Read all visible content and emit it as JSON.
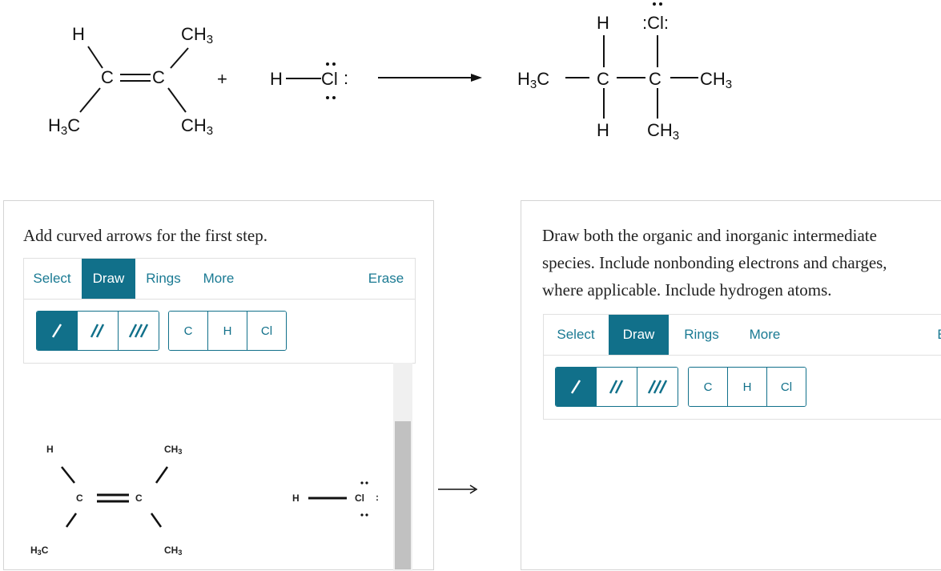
{
  "reaction": {
    "reactant1": {
      "h": "H",
      "ch3_top": "CH",
      "ch3_top_sub": "3",
      "c1": "C",
      "c2": "C",
      "h3c": "H",
      "h3c_sub": "3",
      "h3c_c": "C",
      "ch3_bot": "CH",
      "ch3_bot_sub": "3"
    },
    "plus": "+",
    "reactant2": {
      "h": "H",
      "cl": "Cl",
      "lone_pair": ":"
    },
    "product": {
      "h_top": "H",
      "cl": ":Cl:",
      "h3c": "H",
      "h3c_sub": "3",
      "h3c_c": "C",
      "c1": "C",
      "c2": "C",
      "ch3_right": "CH",
      "ch3_right_sub": "3",
      "h_bot": "H",
      "ch3_bot": "CH",
      "ch3_bot_sub": "3"
    }
  },
  "left_panel": {
    "prompt": "Add curved arrows for the first step.",
    "tabs": {
      "select": "Select",
      "draw": "Draw",
      "rings": "Rings",
      "more": "More",
      "erase": "Erase"
    },
    "atoms": {
      "c": "C",
      "h": "H",
      "cl": "Cl"
    },
    "canvas": {
      "h": "H",
      "ch3_top": "CH",
      "ch3_top_sub": "3",
      "c1": "C",
      "c2": "C",
      "h3c": "H",
      "h3c_sub": "3",
      "h3c_c": "C",
      "ch3_bot": "CH",
      "ch3_bot_sub": "3",
      "h_hcl": "H",
      "cl": "Cl",
      "lone": ":"
    }
  },
  "right_panel": {
    "prompt_line1": "Draw both the organic and inorganic intermediate",
    "prompt_line2": "species. Include nonbonding electrons and charges,",
    "prompt_line3": "where applicable. Include hydrogen atoms.",
    "tabs": {
      "select": "Select",
      "draw": "Draw",
      "rings": "Rings",
      "more": "More",
      "erase": "E"
    },
    "atoms": {
      "c": "C",
      "h": "H",
      "cl": "Cl"
    }
  },
  "colors": {
    "accent": "#11708a",
    "tab_text": "#1a7a93",
    "border": "#d4d4d4"
  }
}
